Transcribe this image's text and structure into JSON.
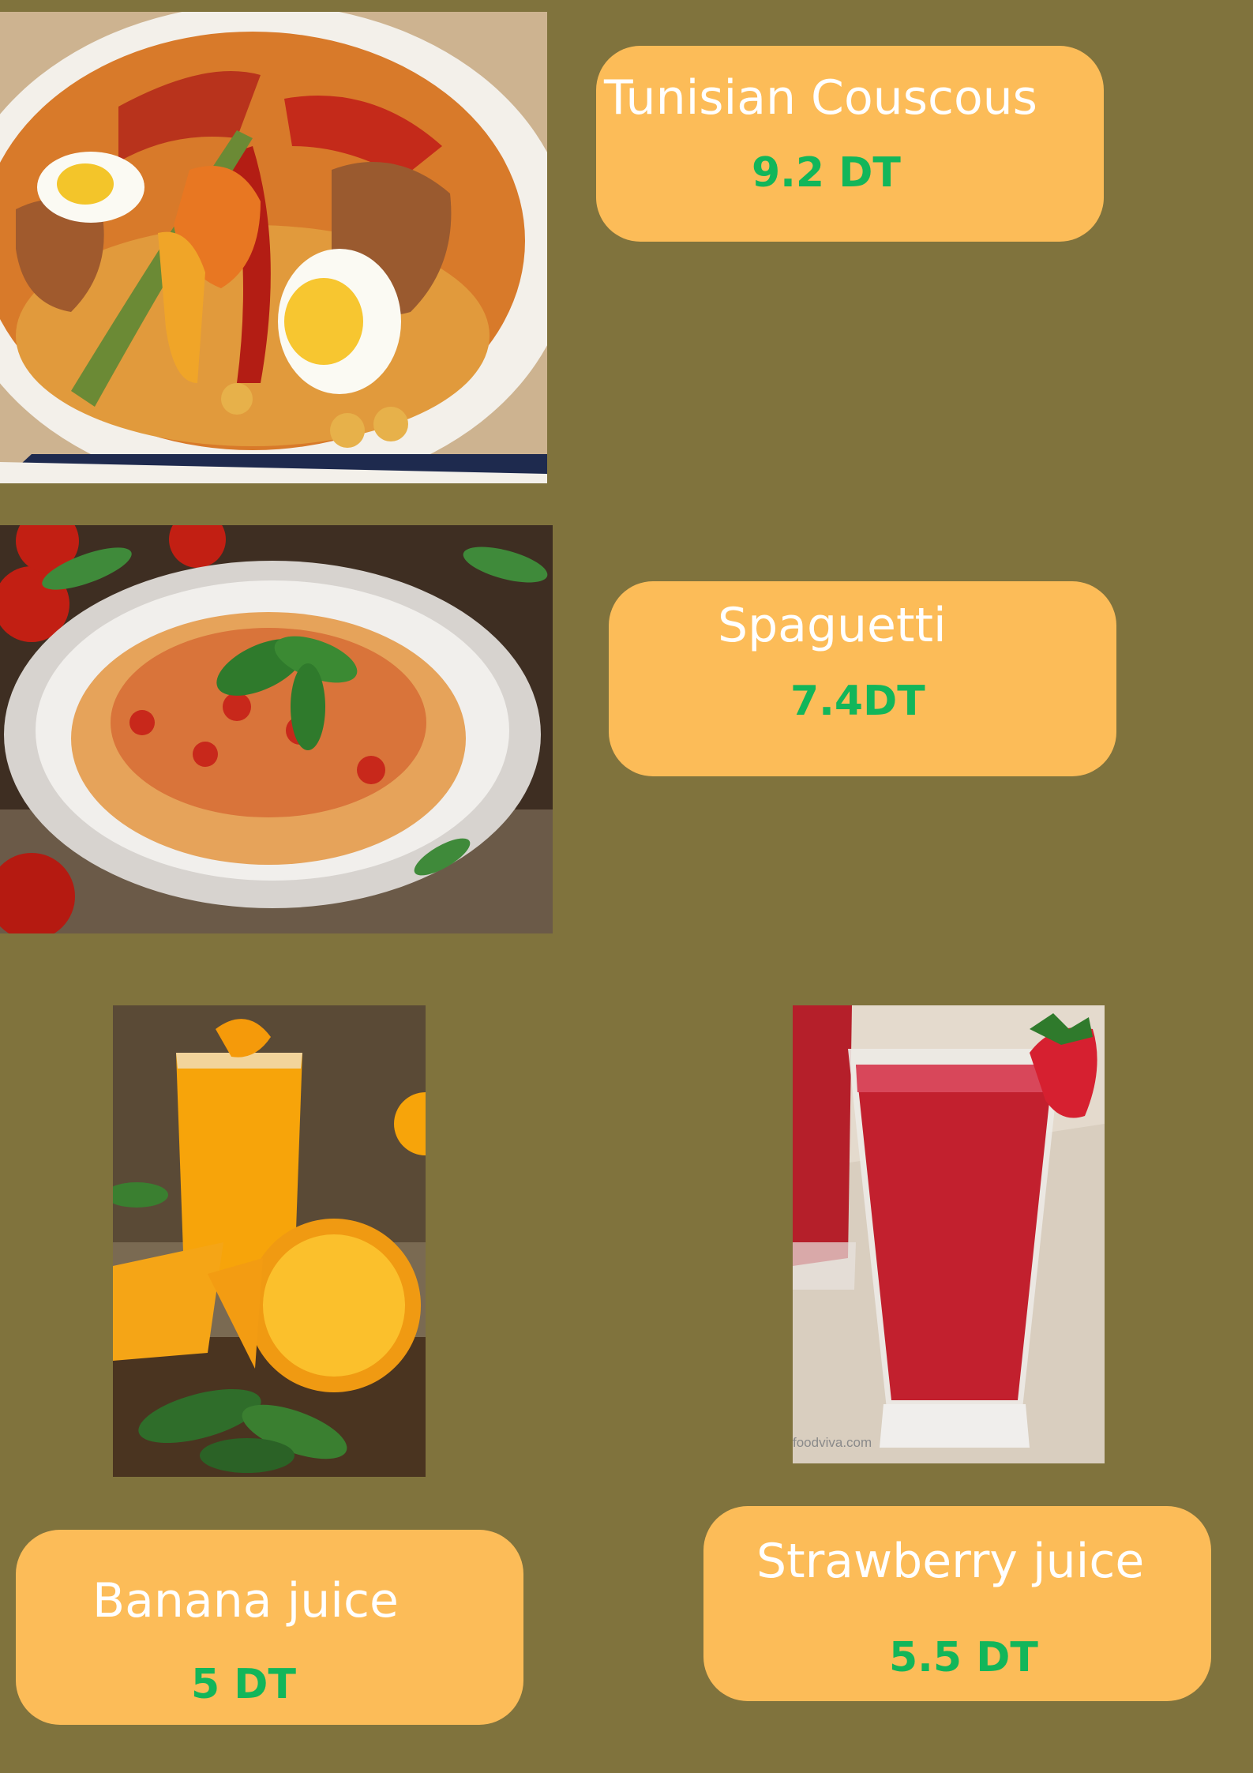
{
  "menu": {
    "items": [
      {
        "name": "Tunisian Couscous",
        "price": "9.2 DT",
        "image": "couscous-photo"
      },
      {
        "name": "Spaguetti",
        "price": "7.4DT",
        "image": "spaghetti-photo"
      },
      {
        "name": "Banana juice",
        "price": "5 DT",
        "image": "orange-juice-photo"
      },
      {
        "name": "Strawberry juice",
        "price": "5.5 DT",
        "image": "strawberry-juice-photo"
      }
    ],
    "watermark": "foodviva.com"
  },
  "colors": {
    "background": "#80733D",
    "card": "#FCBC58",
    "name_text": "#FFFFFF",
    "price_text": "#12B65A"
  }
}
